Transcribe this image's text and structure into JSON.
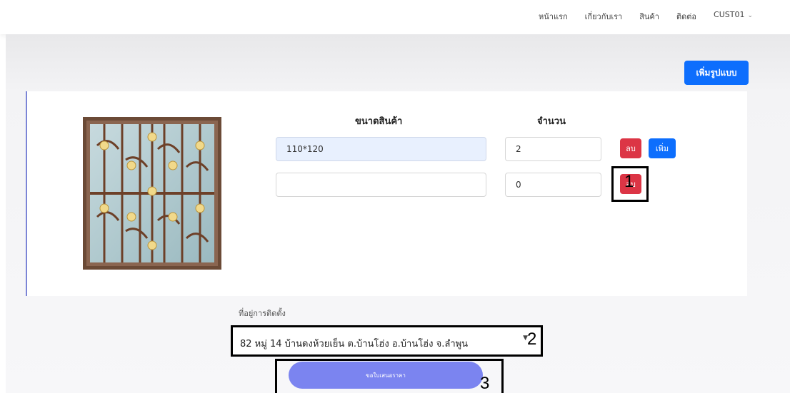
{
  "nav": {
    "items": [
      "หน้าแรก",
      "เกี่ยวกับเรา",
      "สินค้า",
      "ติดต่อ"
    ],
    "user": "CUST01"
  },
  "add_style_label": "เพิ่มรูปแบบ",
  "table": {
    "size_header": "ขนาดสินค้า",
    "qty_header": "จำนวน",
    "rows": [
      {
        "size": "110*120",
        "qty": "2",
        "delete": "ลบ",
        "add": "เพิ่ม"
      },
      {
        "size": "",
        "qty": "0",
        "delete": "ลบ"
      }
    ]
  },
  "address": {
    "label": "ที่อยู่การติดตั้ง",
    "value": "82 หมู่ 14 บ้านดงห้วยเย็น ต.บ้านโฮ่ง อ.บ้านโฮ่ง จ.ลำพูน"
  },
  "submit_label": "ขอใบเสนอราคา",
  "annotations": [
    "1",
    "2",
    "3"
  ],
  "colors": {
    "primary": "#0d6efd",
    "danger": "#dc3545",
    "submit": "#7b84f0",
    "card_accent": "#7b84d6"
  }
}
